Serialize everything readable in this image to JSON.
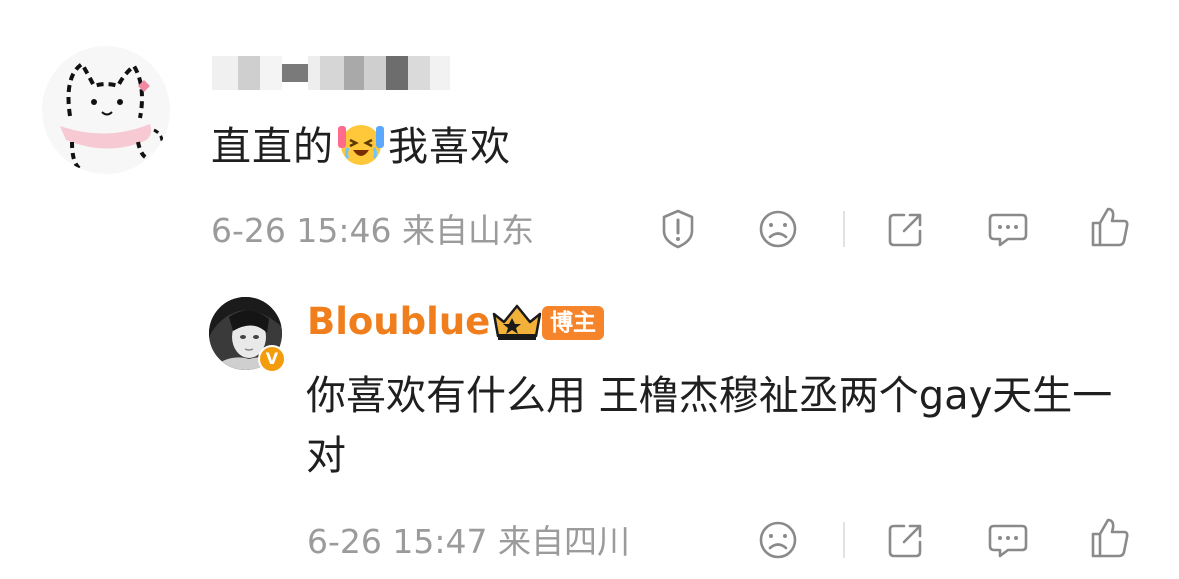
{
  "comment": {
    "text_before_emoji": "直直的",
    "emoji": "laughing-tears-emoji",
    "text_after_emoji": "我喜欢",
    "time": "6-26 15:46",
    "location": "来自山东"
  },
  "reply": {
    "author": "Bloublue",
    "badge_label": "博主",
    "verified_mark": "V",
    "text": "你喜欢有什么用 王橹杰穆祉丞两个gay天生一对",
    "time": "6-26 15:47",
    "location": "来自四川"
  },
  "icons": {
    "report": "report-icon",
    "dislike": "dislike-icon",
    "share": "share-icon",
    "comment": "comment-icon",
    "like": "like-icon"
  },
  "colors": {
    "author_name": "#f07e1c",
    "meta_text": "#9b9b9b",
    "icon_stroke": "#8a8a8a",
    "badge_bg": "#f5842a"
  }
}
